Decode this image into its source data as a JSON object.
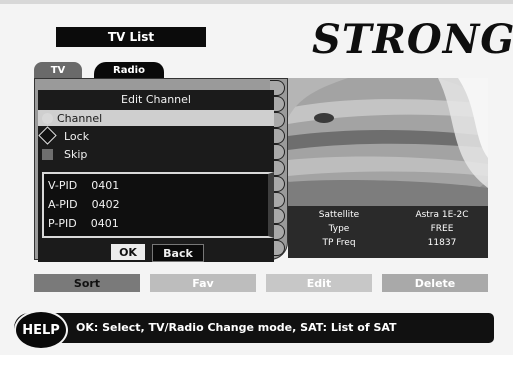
{
  "header": {
    "title": "TV List",
    "logo_text": "STRONG"
  },
  "tabs": [
    "TV",
    "Radio"
  ],
  "dialog": {
    "title": "Edit Channel",
    "options": [
      {
        "label": "Channel",
        "icon": "circle-icon",
        "selected": true
      },
      {
        "label": "Lock",
        "icon": "diamond-icon",
        "selected": false
      },
      {
        "label": "Skip",
        "icon": "square-icon",
        "selected": false
      }
    ],
    "pids": [
      {
        "name": "V-PID",
        "value": "0401"
      },
      {
        "name": "A-PID",
        "value": "0402"
      },
      {
        "name": "P-PID",
        "value": "0401"
      }
    ],
    "ok_label": "OK",
    "back_label": "Back"
  },
  "info": {
    "rows": [
      {
        "key": "Sattellite",
        "value": "Astra 1E-2C"
      },
      {
        "key": "Type",
        "value": "FREE"
      },
      {
        "key": "TP Freq",
        "value": "11837"
      }
    ]
  },
  "function_buttons": {
    "sort": "Sort",
    "fav": "Fav",
    "edit": "Edit",
    "delete": "Delete"
  },
  "help": {
    "badge": "HELP",
    "text": "OK: Select, TV/Radio Change mode, SAT: List of SAT"
  }
}
